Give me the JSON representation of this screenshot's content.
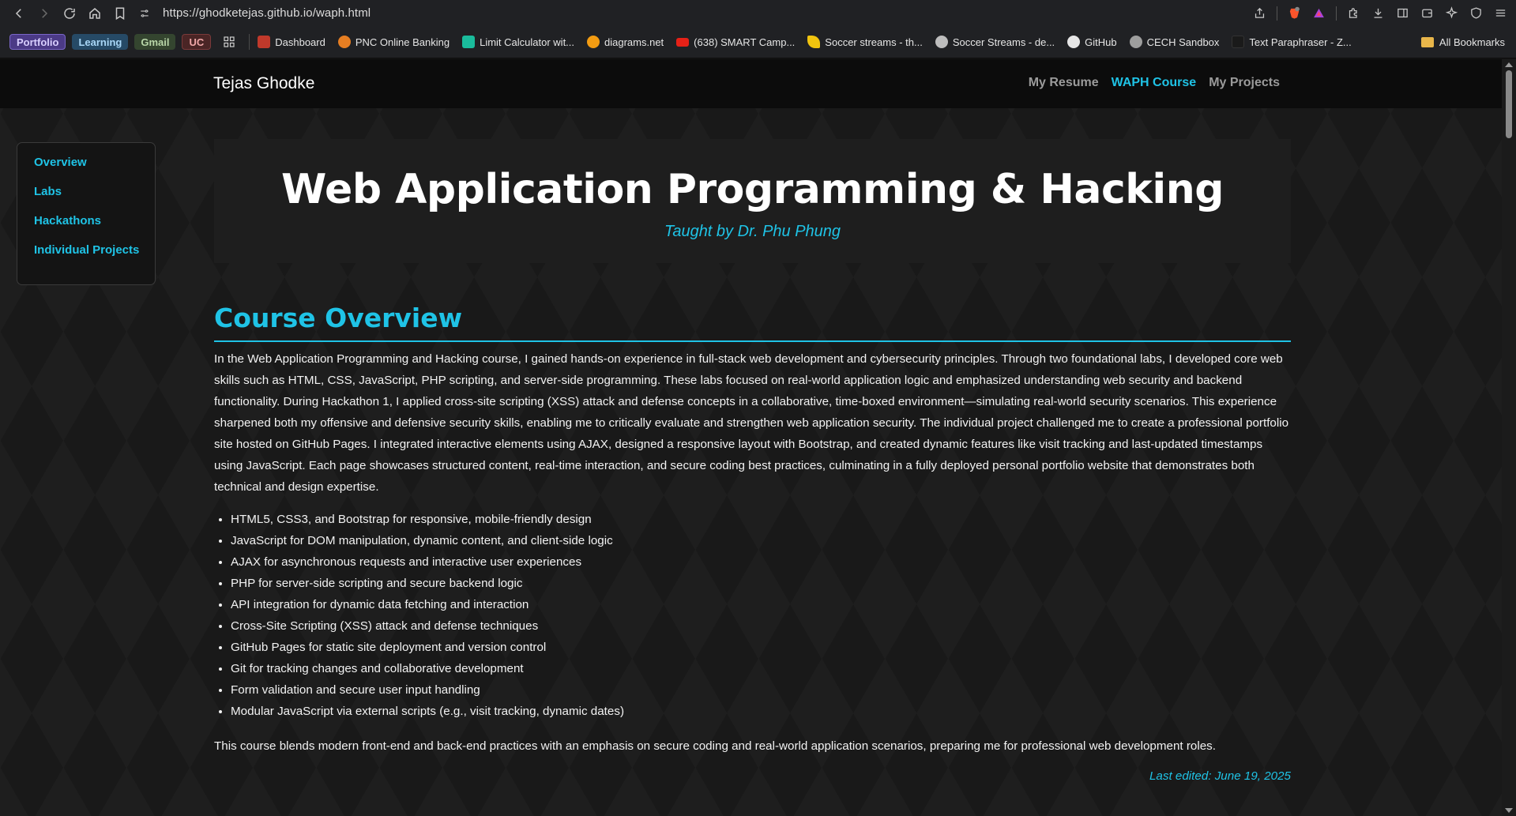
{
  "browser": {
    "url": "https://ghodketejas.github.io/waph.html",
    "tags": [
      "Portfolio",
      "Learning",
      "Gmail",
      "UC"
    ],
    "bookmarks": [
      {
        "label": "Dashboard",
        "color": "#c0392b"
      },
      {
        "label": "PNC Online Banking",
        "color": "#e67e22"
      },
      {
        "label": "Limit Calculator wit...",
        "color": "#1abc9c"
      },
      {
        "label": "diagrams.net",
        "color": "#f39c12"
      },
      {
        "label": "(638) SMART Camp...",
        "color": "#e62117"
      },
      {
        "label": "Soccer streams - th...",
        "color": "#f1c40f"
      },
      {
        "label": "Soccer Streams - de...",
        "color": "#bdbdbd"
      },
      {
        "label": "GitHub",
        "color": "#e6e6e6"
      },
      {
        "label": "CECH Sandbox",
        "color": "#9e9e9e"
      },
      {
        "label": "Text Paraphraser - Z...",
        "color": "#1a1a1a"
      }
    ],
    "more_label": "»",
    "all_bookmarks": "All Bookmarks"
  },
  "site": {
    "brand": "Tejas Ghodke",
    "nav": [
      "My Resume",
      "WAPH Course",
      "My Projects"
    ],
    "active_nav": "WAPH Course",
    "accent": "#1fc3e6"
  },
  "sidebar": {
    "items": [
      "Overview",
      "Labs",
      "Hackathons",
      "Individual Projects"
    ]
  },
  "hero": {
    "title": "Web Application Programming & Hacking",
    "subtitle": "Taught by Dr. Phu Phung"
  },
  "overview": {
    "heading": "Course Overview",
    "paragraph": "In the Web Application Programming and Hacking course, I gained hands-on experience in full-stack web development and cybersecurity principles. Through two foundational labs, I developed core web skills such as HTML, CSS, JavaScript, PHP scripting, and server-side programming. These labs focused on real-world application logic and emphasized understanding web security and backend functionality. During Hackathon 1, I applied cross-site scripting (XSS) attack and defense concepts in a collaborative, time-boxed environment—simulating real-world security scenarios. This experience sharpened both my offensive and defensive security skills, enabling me to critically evaluate and strengthen web application security. The individual project challenged me to create a professional portfolio site hosted on GitHub Pages. I integrated interactive elements using AJAX, designed a responsive layout with Bootstrap, and created dynamic features like visit tracking and last-updated timestamps using JavaScript. Each page showcases structured content, real-time interaction, and secure coding best practices, culminating in a fully deployed personal portfolio website that demonstrates both technical and design expertise.",
    "skills": [
      "HTML5, CSS3, and Bootstrap for responsive, mobile-friendly design",
      "JavaScript for DOM manipulation, dynamic content, and client-side logic",
      "AJAX for asynchronous requests and interactive user experiences",
      "PHP for server-side scripting and secure backend logic",
      "API integration for dynamic data fetching and interaction",
      "Cross-Site Scripting (XSS) attack and defense techniques",
      "GitHub Pages for static site deployment and version control",
      "Git for tracking changes and collaborative development",
      "Form validation and secure user input handling",
      "Modular JavaScript via external scripts (e.g., visit tracking, dynamic dates)"
    ],
    "closing": "This course blends modern front-end and back-end practices with an emphasis on secure coding and real-world application scenarios, preparing me for professional web development roles.",
    "last_edited": "Last edited: June 19, 2025"
  }
}
